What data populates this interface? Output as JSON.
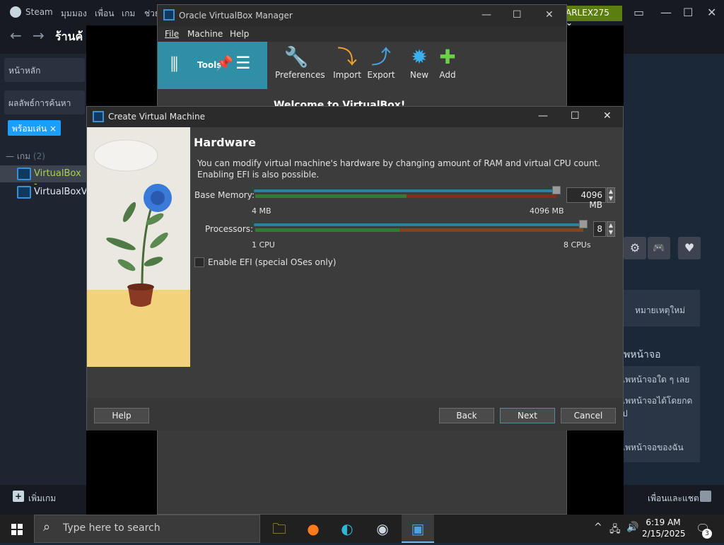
{
  "steam": {
    "menu": [
      "Steam",
      "มุมมอง",
      "เพื่อน",
      "เกม",
      "ช่วย"
    ],
    "store_title": "ร้านค้",
    "sidebar": {
      "home": "หน้าหลัก",
      "search_results": "ผลลัพธ์การค้นหา",
      "ready_tag": "พร้อมเล่น",
      "ready_tag_close": "×",
      "category": "— เกม",
      "category_count": "(2)",
      "games": [
        "VirtualBox -",
        "VirtualBoxV"
      ]
    },
    "username": "ARLEX275",
    "username_chevron": "⌄",
    "right_panel": {
      "news_button": "หมายเหตุใหม่",
      "screenshots_heading": "พหน้าจอ",
      "items": [
        "เพหน้าจอใด ๆ เลย",
        "เพหน้าจอได้โดยกด",
        "ป",
        "เพหน้าจอของฉัน"
      ]
    },
    "bottom": {
      "add_game": "เพิ่มเกม",
      "add_game_icon": "+",
      "friends_chat": "เพื่อนและแชต"
    },
    "window_controls": [
      "▭",
      "—",
      "☐",
      "✕"
    ],
    "quick_icons": [
      "⚙",
      "🎮",
      "♥"
    ]
  },
  "vbox_manager": {
    "title": "Oracle VirtualBox Manager",
    "window_controls": [
      "—",
      "☐",
      "✕"
    ],
    "menu": [
      "File",
      "Machine",
      "Help"
    ],
    "tools_label": "Tools",
    "toolbar": [
      {
        "label": "Preferences",
        "icon": "wrench-icon",
        "glyph": "🔧"
      },
      {
        "label": "Import",
        "icon": "import-icon",
        "glyph": "⤵"
      },
      {
        "label": "Export",
        "icon": "export-icon",
        "glyph": "⤴"
      },
      {
        "label": "New",
        "icon": "new-icon",
        "glyph": "✹"
      },
      {
        "label": "Add",
        "icon": "add-icon",
        "glyph": "✚"
      }
    ],
    "welcome": "Welcome to VirtualBox!"
  },
  "dialog": {
    "title": "Create Virtual Machine",
    "window_controls": [
      "—",
      "☐",
      "✕"
    ],
    "heading": "Hardware",
    "description_line1": "You can modify virtual machine's hardware by changing amount of RAM and virtual CPU count.",
    "description_line2": "Enabling EFI is also possible.",
    "base_memory": {
      "label": "Base Memory:",
      "value": "4096 MB",
      "min_label": "4 MB",
      "max_label": "4096 MB",
      "level": 1.0
    },
    "processors": {
      "label": "Processors:",
      "value": "8",
      "min_label": "1 CPU",
      "max_label": "8 CPUs",
      "level": 1.0
    },
    "efi_label": "Enable EFI (special OSes only)",
    "efi_checked": false,
    "spin_up": "▲",
    "spin_down": "▼",
    "buttons": {
      "help": "Help",
      "back": "Back",
      "next": "Next",
      "cancel": "Cancel"
    }
  },
  "taskbar": {
    "search_placeholder": "Type here to search",
    "search_icon": "⌕",
    "apps": [
      {
        "name": "file-explorer",
        "glyph": "🗀",
        "color": "#f0c040"
      },
      {
        "name": "firefox",
        "glyph": "●",
        "color": "#ff7a1a"
      },
      {
        "name": "edge",
        "glyph": "◐",
        "color": "#2fb7d8"
      },
      {
        "name": "steam",
        "glyph": "◉",
        "color": "#cfd8e0"
      },
      {
        "name": "virtualbox",
        "glyph": "▣",
        "color": "#4aa3df"
      }
    ],
    "tray_icons": [
      "^",
      "🖧",
      "🔊"
    ],
    "time": "6:19 AM",
    "date": "2/15/2025",
    "notifications": "3",
    "notification_icon": "🗨"
  },
  "colors": {
    "steam_bg": "#1b2838",
    "vbox_tools": "#2f8fa6",
    "dialog_bg": "#3c3c3c",
    "slider_green": "#2e7d32",
    "slider_red": "#8a2a1a"
  }
}
